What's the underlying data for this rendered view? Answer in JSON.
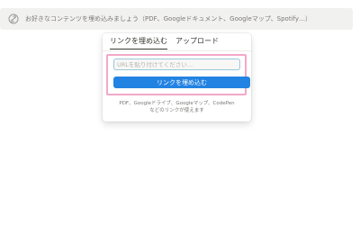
{
  "embed_bar": {
    "icon": "embed-icon",
    "placeholder_text": "お好きなコンテンツを埋め込みましょう（PDF、Googleドキュメント、Googleマップ、Spotify…）"
  },
  "popover": {
    "tabs": [
      {
        "label": "リンクを埋め込む",
        "active": true
      },
      {
        "label": "アップロード",
        "active": false
      }
    ],
    "url_input": {
      "placeholder": "URLを貼り付けてください…",
      "value": ""
    },
    "embed_button": {
      "label": "リンクを埋め込む"
    },
    "hint_line1": "PDF、Googleドライブ、Googleマップ、CodePen",
    "hint_line2": "などのリンクが使えます"
  },
  "colors": {
    "accent": "#2383e2",
    "highlight_border": "#f3a8c8",
    "input_focus_border": "#9bc6d8",
    "embed_bar_bg": "#f1f1ef"
  }
}
